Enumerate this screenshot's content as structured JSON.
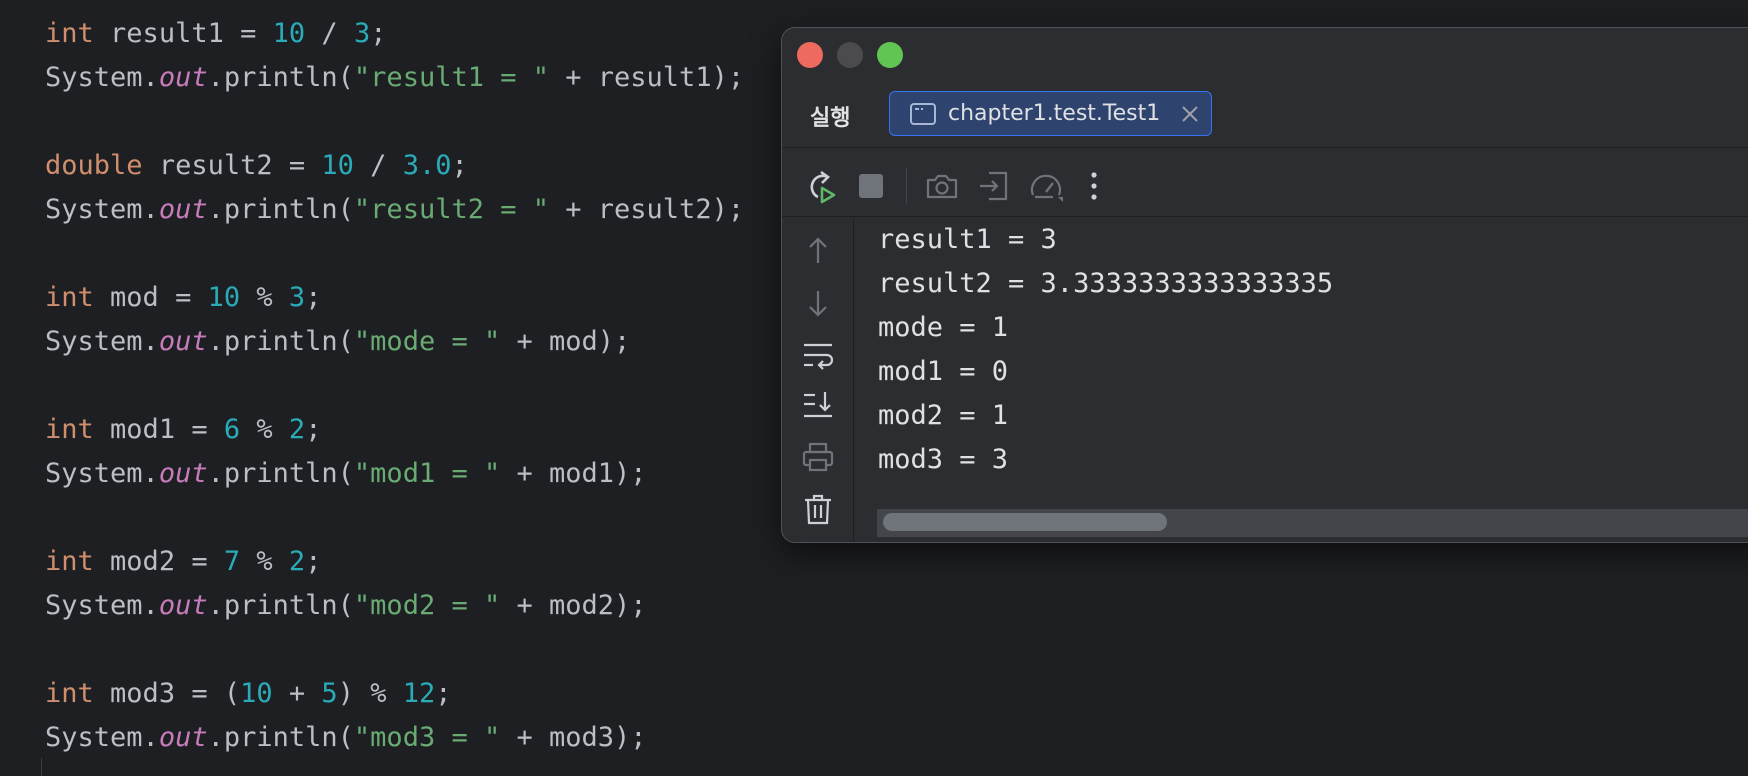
{
  "editor": {
    "lines": [
      {
        "type": "decl",
        "kw": "int",
        "var": "result1",
        "a": "10",
        "op": "/",
        "b": "3"
      },
      {
        "type": "print",
        "cls": "System",
        "fld": "out",
        "method": "println",
        "str": "\"result1 = \"",
        "arg": "result1"
      },
      {
        "type": "blank"
      },
      {
        "type": "decl",
        "kw": "double",
        "var": "result2",
        "a": "10",
        "op": "/",
        "b": "3.0"
      },
      {
        "type": "print",
        "cls": "System",
        "fld": "out",
        "method": "println",
        "str": "\"result2 = \"",
        "arg": "result2"
      },
      {
        "type": "blank"
      },
      {
        "type": "decl",
        "kw": "int",
        "var": "mod",
        "a": "10",
        "op": "%",
        "b": "3"
      },
      {
        "type": "print",
        "cls": "System",
        "fld": "out",
        "method": "println",
        "str": "\"mode = \"",
        "arg": "mod"
      },
      {
        "type": "blank"
      },
      {
        "type": "decl",
        "kw": "int",
        "var": "mod1",
        "a": "6",
        "op": "%",
        "b": "2"
      },
      {
        "type": "print",
        "cls": "System",
        "fld": "out",
        "method": "println",
        "str": "\"mod1 = \"",
        "arg": "mod1"
      },
      {
        "type": "blank"
      },
      {
        "type": "decl",
        "kw": "int",
        "var": "mod2",
        "a": "7",
        "op": "%",
        "b": "2"
      },
      {
        "type": "print",
        "cls": "System",
        "fld": "out",
        "method": "println",
        "str": "\"mod2 = \"",
        "arg": "mod2"
      },
      {
        "type": "blank"
      },
      {
        "type": "paren",
        "kw": "int",
        "var": "mod3",
        "a": "10",
        "op1": "+",
        "b": "5",
        "op2": "%",
        "c": "12"
      },
      {
        "type": "print",
        "cls": "System",
        "fld": "out",
        "method": "println",
        "str": "\"mod3 = \"",
        "arg": "mod3"
      }
    ]
  },
  "run_window": {
    "tool_title": "실행",
    "tab_label": "chapter1.test.Test1",
    "toolbar_icons": [
      "rerun-icon",
      "stop-icon",
      "camera-icon",
      "login-icon",
      "gauge-icon",
      "more-vertical-icon"
    ],
    "side_icons": [
      "arrow-up-icon",
      "arrow-down-icon",
      "soft-wrap-icon",
      "scroll-to-end-icon",
      "print-icon",
      "trash-icon"
    ],
    "output": [
      "result1 = 3",
      "result2 = 3.3333333333333335",
      "mode = 1",
      "mod1 = 0",
      "mod2 = 1",
      "mod3 = 3"
    ]
  },
  "colors": {
    "background": "#1e1f22",
    "keyword": "#cf8e6d",
    "number": "#2aacb8",
    "string": "#6aab73",
    "field": "#c77dbb",
    "text": "#bcbec4",
    "tab_selected": "#2e436e",
    "tab_border": "#3574f0",
    "close_light": "#ed6a5e",
    "maximize_light": "#61c554"
  }
}
